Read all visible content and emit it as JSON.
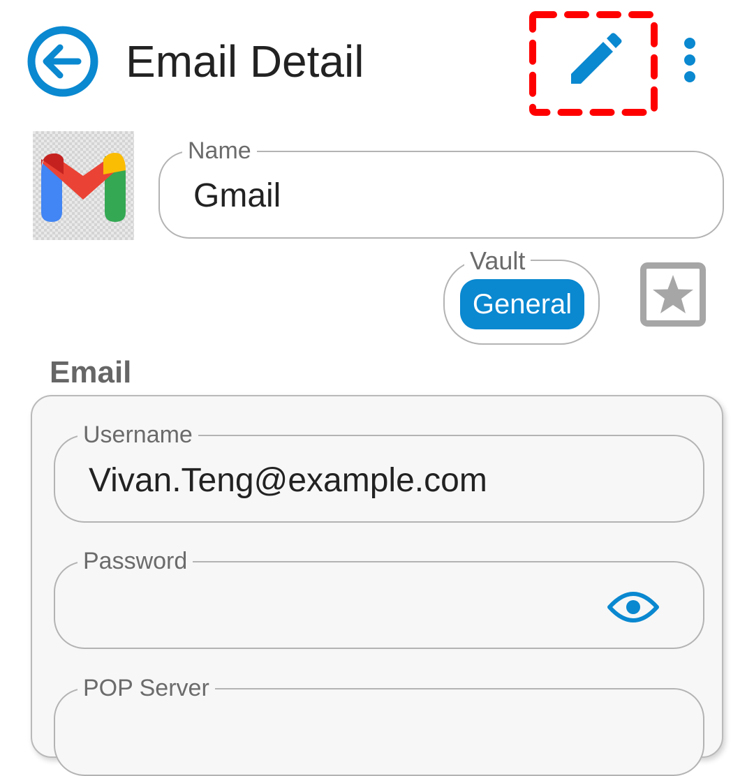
{
  "header": {
    "title": "Email Detail",
    "back_icon": "arrow-left-circle-icon",
    "edit_icon": "pencil-icon",
    "more_icon": "more-vertical-icon"
  },
  "item": {
    "logo_icon": "gmail-logo-icon",
    "name_label": "Name",
    "name_value": "Gmail",
    "vault_label": "Vault",
    "vault_value": "General",
    "favorite_icon": "star-icon"
  },
  "section": {
    "title": "Email",
    "fields": {
      "username_label": "Username",
      "username_value": "Vivan.Teng@example.com",
      "password_label": "Password",
      "password_value": "",
      "password_toggle_icon": "eye-icon",
      "pop_server_label": "POP Server"
    }
  },
  "colors": {
    "accent": "#0a88d0",
    "highlight": "#ff0000",
    "favorite_inactive": "#a6a6a6",
    "outline": "#b3b3b3"
  }
}
